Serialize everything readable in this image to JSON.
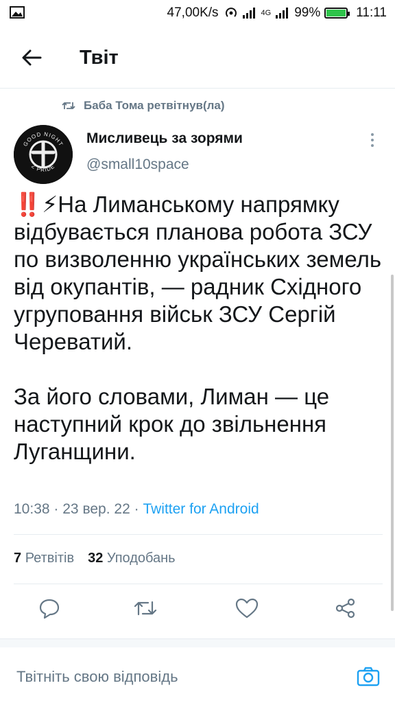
{
  "status_bar": {
    "speed": "47,00K/s",
    "network": "4G",
    "battery_percent": "99%",
    "battery_level": 0.99,
    "time": "11:11"
  },
  "header": {
    "title": "Твіт"
  },
  "retweet_context": {
    "text": "Баба Тома ретвітнув(ла)"
  },
  "author": {
    "name": "Мисливець за зорями",
    "handle": "@small10space",
    "avatar_text_top": "GOOD NIGHT",
    "avatar_text_bottom": "Z PRIDE"
  },
  "tweet": {
    "text": "‼️⚡На Лиманському напрямку відбувається планова робота ЗСУ по визволенню українських земель від окупантів, — радник Східного угруповання військ ЗСУ Сергій Череватий.\n\nЗа його словами, Лиман — це наступний крок до звільнення Луганщини.",
    "time": "10:38",
    "date": "23 вер. 22",
    "separator": "·",
    "source": "Twitter for Android"
  },
  "stats": {
    "retweets_count": "7",
    "retweets_label": "Ретвітів",
    "likes_count": "32",
    "likes_label": "Уподобань"
  },
  "actions": {
    "icons": [
      "reply-icon",
      "retweet-icon",
      "like-icon",
      "share-icon"
    ]
  },
  "reply": {
    "placeholder": "Твітніть свою відповідь"
  },
  "colors": {
    "accent": "#1da1f2",
    "muted": "#657786",
    "divider": "#e6ecf0"
  }
}
